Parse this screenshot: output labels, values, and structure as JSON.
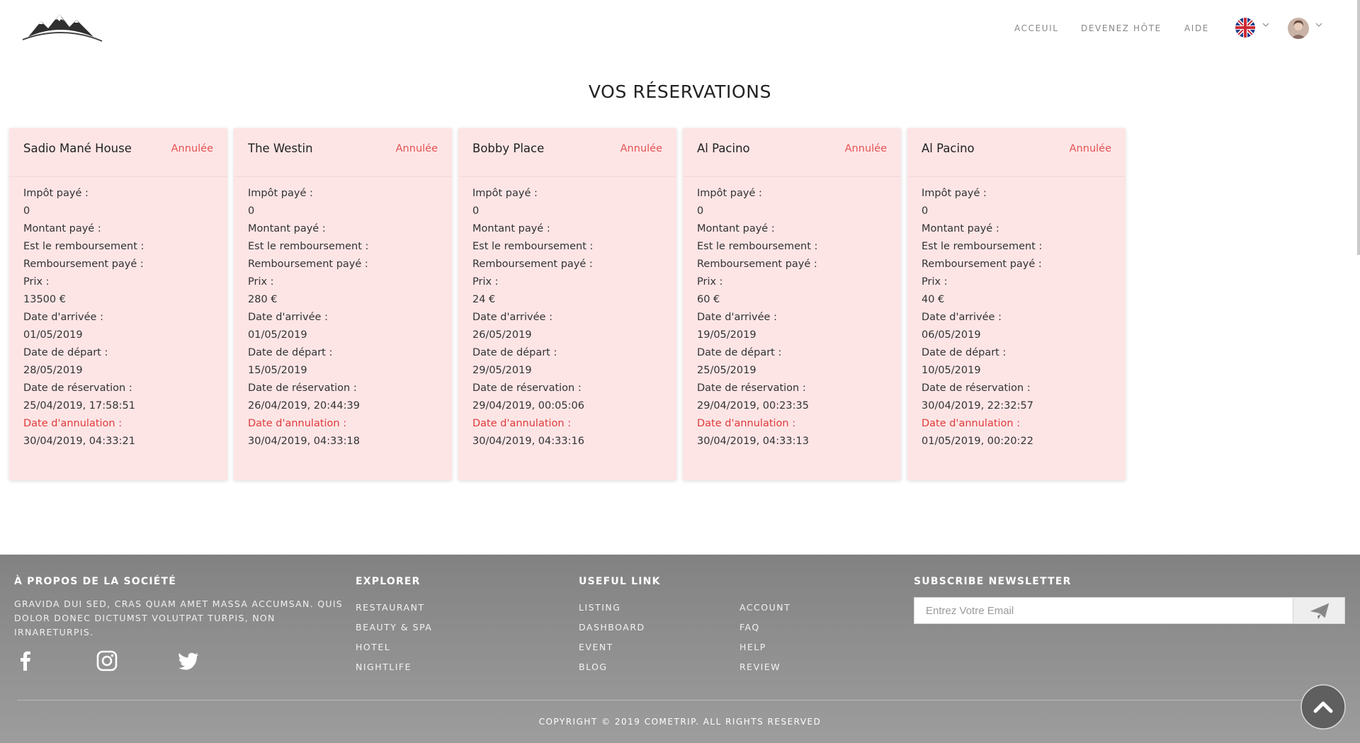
{
  "header": {
    "logo_icon": "mountain-logo",
    "nav": [
      {
        "label": "ACCEUIL"
      },
      {
        "label": "DEVENEZ HÔTE"
      },
      {
        "label": "AIDE"
      }
    ],
    "language_icon": "uk-flag-icon",
    "user_icon": "user-avatar"
  },
  "page": {
    "title": "VOS RÉSERVATIONS"
  },
  "labels": {
    "impot": "Impôt payé :",
    "montant": "Montant payé :",
    "est_remboursement": "Est le remboursement :",
    "remboursement_paye": "Remboursement payé :",
    "prix": "Prix :",
    "arrivee": "Date d'arrivée :",
    "depart": "Date de départ :",
    "reservation": "Date de réservation :",
    "annulation": "Date d'annulation :"
  },
  "reservations": [
    {
      "name": "Sadio Mané House",
      "status": "Annulée",
      "impot": "0",
      "prix": "13500 €",
      "arrivee": "01/05/2019",
      "depart": "28/05/2019",
      "reservation": "25/04/2019, 17:58:51",
      "annulation": "30/04/2019, 04:33:21"
    },
    {
      "name": "The Westin",
      "status": "Annulée",
      "impot": "0",
      "prix": "280 €",
      "arrivee": "01/05/2019",
      "depart": "15/05/2019",
      "reservation": "26/04/2019, 20:44:39",
      "annulation": "30/04/2019, 04:33:18"
    },
    {
      "name": "Bobby Place",
      "status": "Annulée",
      "impot": "0",
      "prix": "24 €",
      "arrivee": "26/05/2019",
      "depart": "29/05/2019",
      "reservation": "29/04/2019, 00:05:06",
      "annulation": "30/04/2019, 04:33:16"
    },
    {
      "name": "Al Pacino",
      "status": "Annulée",
      "impot": "0",
      "prix": "60 €",
      "arrivee": "19/05/2019",
      "depart": "25/05/2019",
      "reservation": "29/04/2019, 00:23:35",
      "annulation": "30/04/2019, 04:33:13"
    },
    {
      "name": "Al Pacino",
      "status": "Annulée",
      "impot": "0",
      "prix": "40 €",
      "arrivee": "06/05/2019",
      "depart": "10/05/2019",
      "reservation": "30/04/2019, 22:32:57",
      "annulation": "01/05/2019, 00:20:22"
    }
  ],
  "colors": {
    "card_bg": "#fde5e6",
    "status_red": "#e55353",
    "footer_bg": "#8f8f8f"
  },
  "footer": {
    "about": {
      "title": "À PROPOS DE LA SOCIÉTÉ",
      "text": "GRAVIDA DUI SED, CRAS QUAM AMET MASSA ACCUMSAN. QUIS DOLOR DONEC DICTUMST VOLUTPAT TURPIS, NON IRNARETURPIS."
    },
    "social_icons": [
      "facebook-icon",
      "instagram-icon",
      "twitter-icon"
    ],
    "explorer": {
      "title": "EXPLORER",
      "links": [
        "RESTAURANT",
        "BEAUTY & SPA",
        "HOTEL",
        "NIGHTLIFE"
      ]
    },
    "useful": {
      "title": "USEFUL LINK",
      "links_col1": [
        "LISTING",
        "DASHBOARD",
        "EVENT",
        "BLOG"
      ],
      "links_col2": [
        "ACCOUNT",
        "FAQ",
        "HELP",
        "REVIEW"
      ]
    },
    "newsletter": {
      "title": "SUBSCRIBE NEWSLETTER",
      "placeholder": "Entrez Votre Email",
      "value": "",
      "send_icon": "paper-plane-icon"
    },
    "copyright": "COPYRIGHT © 2019 COMETRIP. ALL RIGHTS RESERVED",
    "scroll_top_icon": "chevron-up-icon"
  }
}
